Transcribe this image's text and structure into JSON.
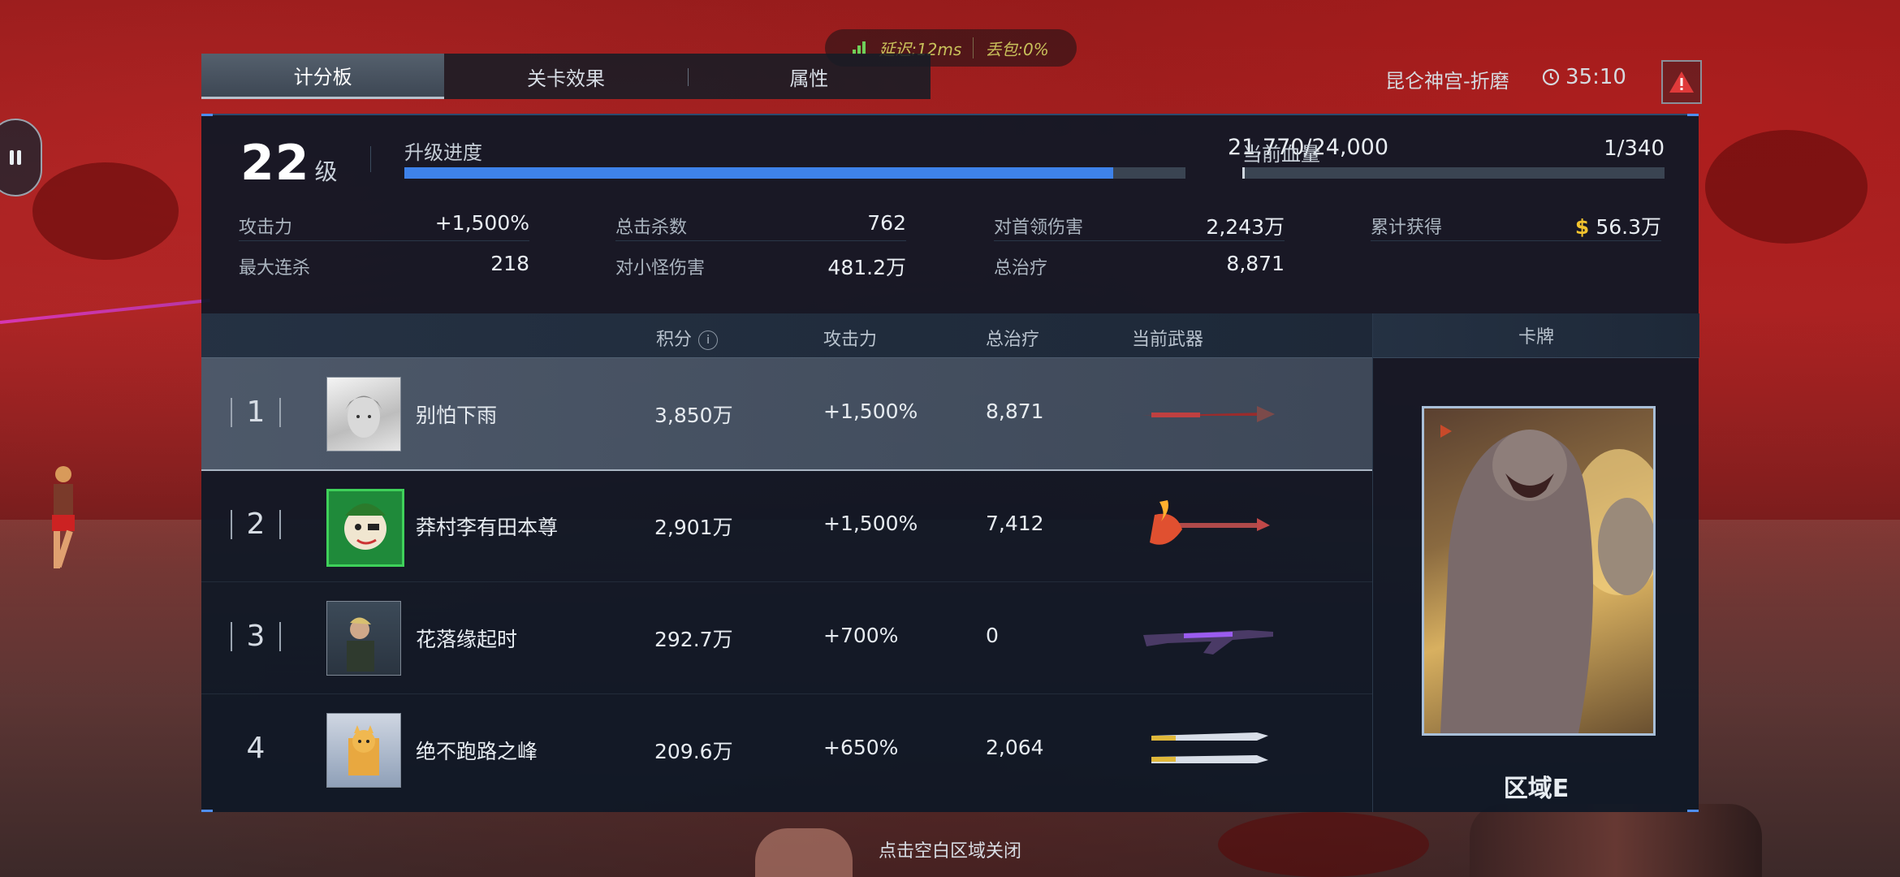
{
  "network": {
    "latency_label": "延迟:12ms",
    "loss_label": "丢包:0%"
  },
  "tabs": [
    "计分板",
    "关卡效果",
    "属性"
  ],
  "map_name": "昆仑神宫-折磨",
  "timer": "35:10",
  "level": {
    "number": "22",
    "unit": "级"
  },
  "xp": {
    "label": "升级进度",
    "value": "21,770/24,000",
    "progress": 0.907
  },
  "hp": {
    "label": "当前血量",
    "value": "1/340",
    "progress": 0.003
  },
  "stats": {
    "attack": {
      "label": "攻击力",
      "value": "+1,500%"
    },
    "max_streak": {
      "label": "最大连杀",
      "value": "218"
    },
    "total_kills": {
      "label": "总击杀数",
      "value": "762"
    },
    "minion_damage": {
      "label": "对小怪伤害",
      "value": "481.2万"
    },
    "boss_damage": {
      "label": "对首领伤害",
      "value": "2,243万"
    },
    "total_heal": {
      "label": "总治疗",
      "value": "8,871"
    },
    "earned": {
      "label": "累计获得",
      "value": "56.3万",
      "currency_icon": "$"
    }
  },
  "table": {
    "headers": {
      "score": "积分",
      "attack": "攻击力",
      "heal": "总治疗",
      "weapon": "当前武器",
      "card": "卡牌"
    },
    "rows": [
      {
        "rank": "1",
        "name": "别怕下雨",
        "score": "3,850万",
        "attack": "+1,500%",
        "heal": "8,871",
        "weapon_icon": "spear-icon"
      },
      {
        "rank": "2",
        "name": "莽村李有田本尊",
        "score": "2,901万",
        "attack": "+1,500%",
        "heal": "7,412",
        "weapon_icon": "flame-axe-icon"
      },
      {
        "rank": "3",
        "name": "花落缘起时",
        "score": "292.7万",
        "attack": "+700%",
        "heal": "0",
        "weapon_icon": "rifle-icon"
      },
      {
        "rank": "4",
        "name": "绝不跑路之峰",
        "score": "209.6万",
        "attack": "+650%",
        "heal": "2,064",
        "weapon_icon": "dual-blades-icon"
      }
    ]
  },
  "card": {
    "zone": "区域E"
  },
  "close_hint": "点击空白区域关闭",
  "colors": {
    "accent_blue": "#3e82ea",
    "coin_gold": "#f2c32e",
    "panel_bg": "#0e1826"
  }
}
